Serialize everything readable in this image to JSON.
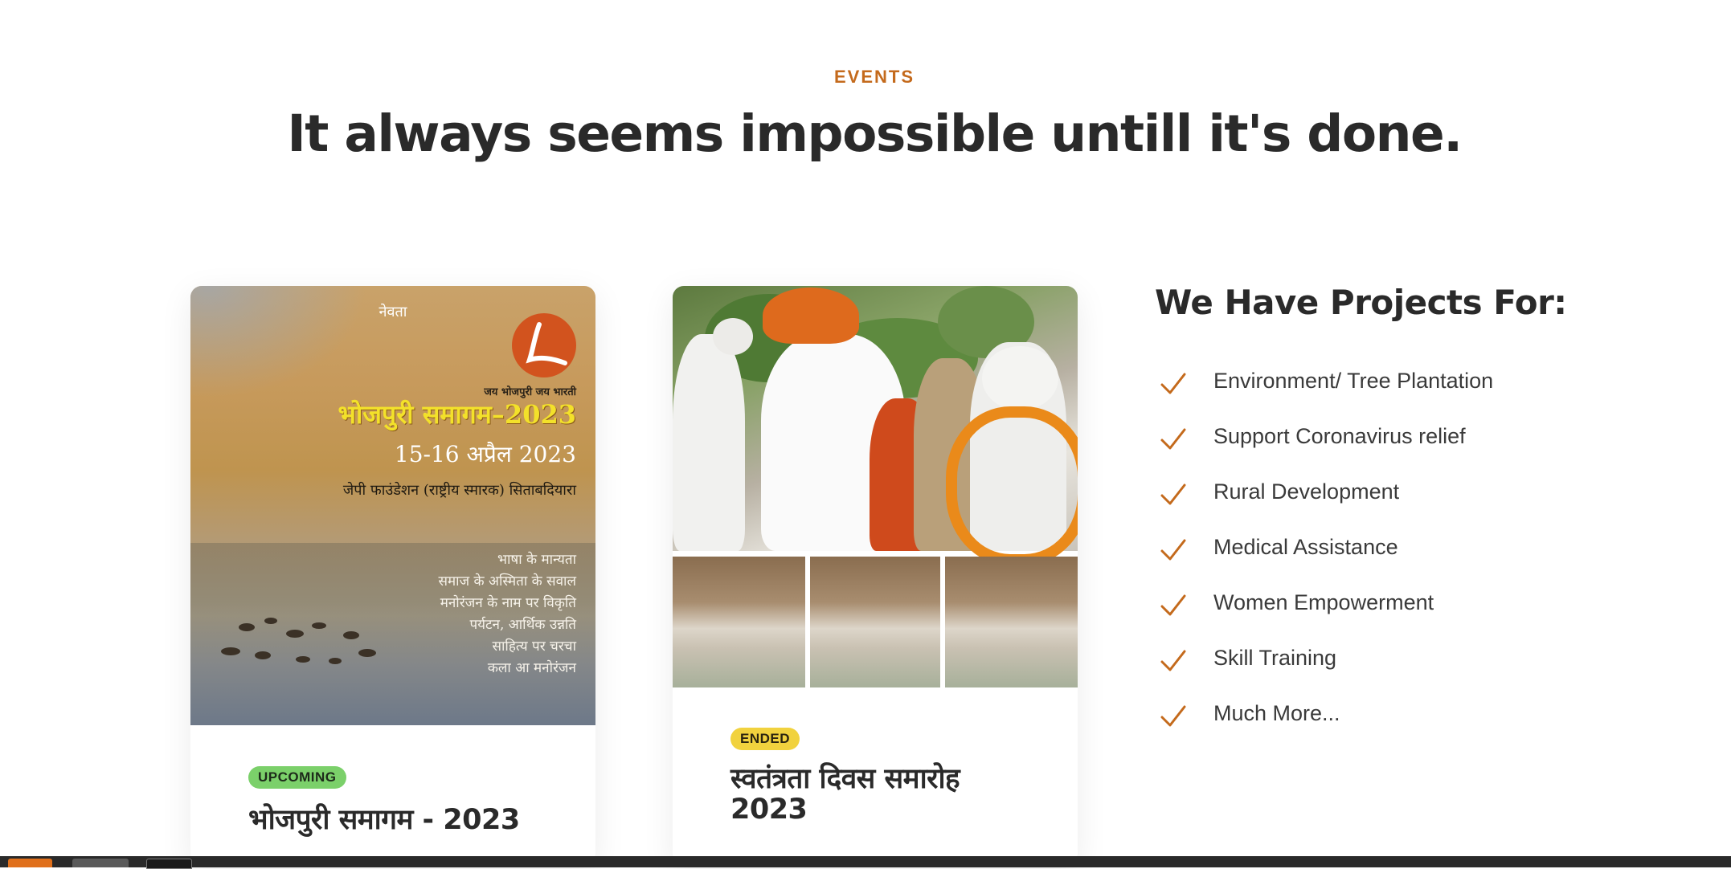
{
  "section": {
    "eyebrow": "EVENTS",
    "headline": "It always seems impossible untill it's done."
  },
  "events": [
    {
      "status": "UPCOMING",
      "title": "भोजपुरी समागम - 2023",
      "poster": {
        "invite": "नेवता",
        "slogan": "जय भोजपुरी  जय भारती",
        "title": "भोजपुरी समागम–2023",
        "date": "15-16 अप्रैल 2023",
        "venue": "जेपी फाउंडेशन (राष्ट्रीय स्मारक) सिताबदियारा",
        "topics": [
          "भाषा के मान्यता",
          "समाज के अस्मिता के सवाल",
          "मनोरंजन के नाम पर विकृति",
          "पर्यटन, आर्थिक उन्नति",
          "साहित्य पर चरचा",
          "कला आ मनोरंजन"
        ]
      }
    },
    {
      "status": "ENDED",
      "title": "स्वतंत्रता दिवस समारोह 2023"
    }
  ],
  "projects": {
    "title": "We Have Projects For:",
    "items": [
      "Environment/ Tree Plantation",
      "Support Coronavirus relief",
      "Rural Development",
      "Medical Assistance",
      "Women Empowerment",
      "Skill Training",
      "Much More..."
    ]
  },
  "colors": {
    "accent": "#c46a1c",
    "upcoming": "#7bd06a",
    "ended": "#f1d23e"
  }
}
